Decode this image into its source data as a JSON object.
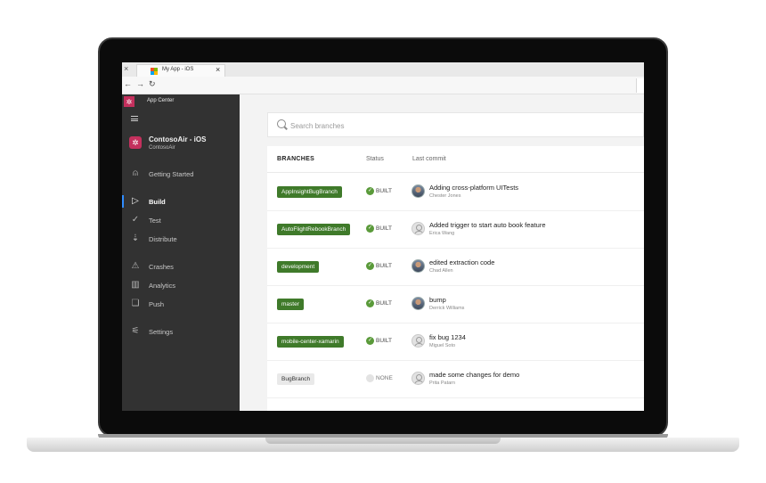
{
  "browser": {
    "tab_title": "My App - iOS",
    "tab_close": "×",
    "left_close": "×",
    "back": "←",
    "forward": "→",
    "refresh": "↻",
    "ms_logo_colors": [
      "#f25022",
      "#7fba00",
      "#00a4ef",
      "#ffb900"
    ]
  },
  "sidebar": {
    "brand_tile": "✲",
    "brand_name": "App Center",
    "app_icon": "✲",
    "app_name": "ContosoAir - iOS",
    "app_org": "ContosoAir",
    "items": [
      {
        "label": "Getting Started",
        "icon": "rocket-icon",
        "glyph": "⍝"
      },
      {
        "label": "Build",
        "icon": "play-icon",
        "glyph": "▷",
        "active": true
      },
      {
        "label": "Test",
        "icon": "check-circle-icon",
        "glyph": "✓"
      },
      {
        "label": "Distribute",
        "icon": "distribute-icon",
        "glyph": "⇣"
      },
      {
        "label": "Crashes",
        "icon": "warning-icon",
        "glyph": "⚠"
      },
      {
        "label": "Analytics",
        "icon": "bar-chart-icon",
        "glyph": "▥"
      },
      {
        "label": "Push",
        "icon": "push-icon",
        "glyph": "❏"
      },
      {
        "label": "Settings",
        "icon": "sliders-icon",
        "glyph": "⚟"
      }
    ],
    "accent": "#2f8cff",
    "brand_color": "#c4305d"
  },
  "search": {
    "placeholder": "Search branches",
    "value": ""
  },
  "table": {
    "headers": {
      "branches": "BRANCHES",
      "status": "Status",
      "last_commit": "Last commit"
    },
    "rows": [
      {
        "branch": "AppInsightBugBranch",
        "status": "BUILT",
        "built": true,
        "message": "Adding cross-platform UITests",
        "author": "Chester Jones",
        "avatar": "photo"
      },
      {
        "branch": "AutoFlightRebookBranch",
        "status": "BUILT",
        "built": true,
        "message": "Added trigger to start auto book feature",
        "author": "Erica Wang",
        "avatar": "placeholder"
      },
      {
        "branch": "development",
        "status": "BUILT",
        "built": true,
        "message": "edited extraction code",
        "author": "Chad Allen",
        "avatar": "photo"
      },
      {
        "branch": "master",
        "status": "BUILT",
        "built": true,
        "message": "bump",
        "author": "Derrick Williams",
        "avatar": "photo"
      },
      {
        "branch": "mobile-center-xamarin",
        "status": "BUILT",
        "built": true,
        "message": "fix bug 1234",
        "author": "Miguel Soto",
        "avatar": "placeholder"
      },
      {
        "branch": "BugBranch",
        "status": "NONE",
        "built": false,
        "message": "made some changes for demo",
        "author": "Prita Patarn",
        "avatar": "placeholder"
      }
    ],
    "built_color": "#3f7a2a",
    "check_glyph": "✓"
  }
}
